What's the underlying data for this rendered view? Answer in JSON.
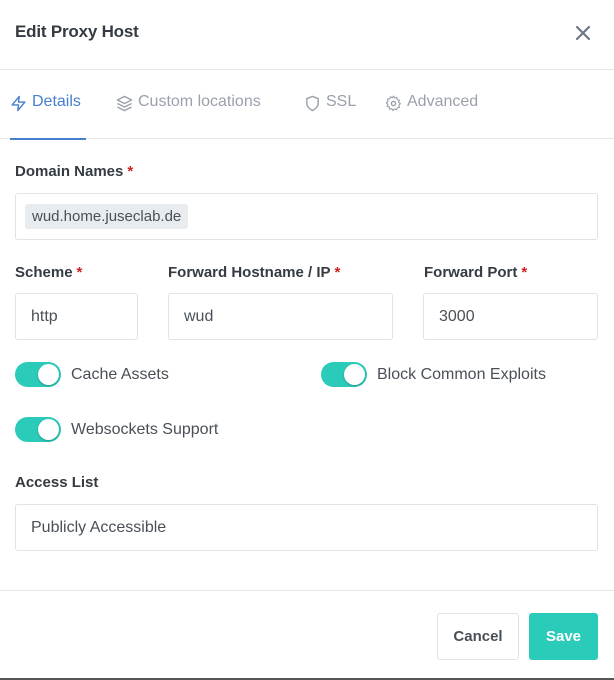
{
  "modal": {
    "title": "Edit Proxy Host",
    "close_icon": "close-icon"
  },
  "tabs": [
    {
      "label": "Details",
      "icon": "bolt-icon",
      "active": true
    },
    {
      "label": "Custom locations",
      "icon": "layers-icon",
      "active": false
    },
    {
      "label": "SSL",
      "icon": "shield-icon",
      "active": false
    },
    {
      "label": "Advanced",
      "icon": "gear-icon",
      "active": false
    }
  ],
  "form": {
    "domain_names": {
      "label": "Domain Names",
      "required_mark": "*",
      "tags": [
        "wud.home.juseclab.de"
      ]
    },
    "scheme": {
      "label": "Scheme",
      "required_mark": "*",
      "value": "http"
    },
    "forward_hostname": {
      "label": "Forward Hostname / IP",
      "required_mark": "*",
      "value": "wud"
    },
    "forward_port": {
      "label": "Forward Port",
      "required_mark": "*",
      "value": "3000"
    },
    "toggles": [
      {
        "label": "Cache Assets",
        "checked": true
      },
      {
        "label": "Block Common Exploits",
        "checked": true
      },
      {
        "label": "Websockets Support",
        "checked": true
      }
    ],
    "access_list": {
      "label": "Access List",
      "value": "Publicly Accessible"
    }
  },
  "footer": {
    "cancel_label": "Cancel",
    "save_label": "Save"
  },
  "colors": {
    "accent": "#467fcf",
    "toggle_on": "#2bcbba",
    "save_button": "#2bcbba",
    "required": "#cd201f"
  }
}
